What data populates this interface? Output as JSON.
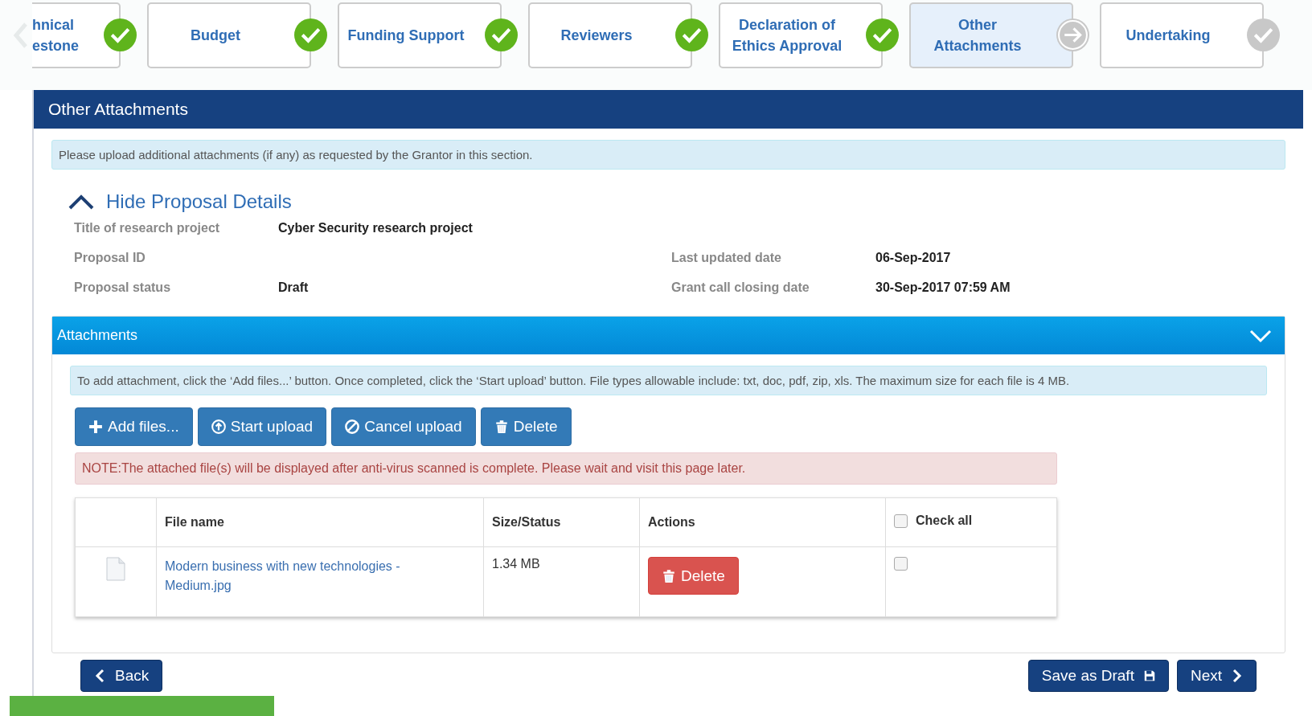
{
  "steps": [
    {
      "lines": [
        "hnical",
        "estone"
      ],
      "kind": "done",
      "selected": false
    },
    {
      "lines": [
        "Budget"
      ],
      "kind": "done",
      "selected": false
    },
    {
      "lines": [
        "Funding Support"
      ],
      "kind": "done",
      "selected": false
    },
    {
      "lines": [
        "Reviewers"
      ],
      "kind": "done",
      "selected": false
    },
    {
      "lines": [
        "Declaration of",
        "Ethics Approval"
      ],
      "kind": "done",
      "selected": false
    },
    {
      "lines": [
        "Other",
        "Attachments"
      ],
      "kind": "current",
      "selected": true
    },
    {
      "lines": [
        "Undertaking"
      ],
      "kind": "pending",
      "selected": false
    }
  ],
  "panel": {
    "title": "Other Attachments",
    "intro": "Please upload additional attachments (if any) as requested by the Grantor in this section."
  },
  "details": {
    "toggle": "Hide Proposal Details",
    "rows": [
      [
        {
          "label": "Title of research project",
          "value": "Cyber Security research project"
        }
      ],
      [
        {
          "label": "Proposal ID"
        },
        {
          "label": "Last updated date",
          "value": "06-Sep-2017"
        }
      ],
      [
        {
          "label": "Proposal status",
          "value": "Draft"
        },
        {
          "label": "Grant call closing date",
          "value": "30-Sep-2017 07:59 AM"
        }
      ]
    ]
  },
  "attachments": {
    "title": "Attachments",
    "help": "To add attachment, click the ‘Add files...’ button. Once completed, click the ‘Start upload’ button. File types allowable include: txt, doc, pdf, zip, xls. The maximum size for each file is 4 MB.",
    "toolbar": [
      {
        "label": "Add files...",
        "kind": "add"
      },
      {
        "label": "Start upload",
        "kind": "upload"
      },
      {
        "label": "Cancel upload",
        "kind": "cancel"
      },
      {
        "label": "Delete",
        "kind": "delete"
      }
    ],
    "note": "NOTE:The attached file(s) will be displayed after anti-virus scanned is complete. Please wait and visit this page later.",
    "columns": [
      "File name",
      "Size/Status",
      "Actions",
      "Check all"
    ],
    "check_all": false,
    "rows": [
      {
        "file": "Modern business with new technologies - Medium.jpg",
        "size": "1.34 MB",
        "action": "Delete",
        "checked": false
      }
    ]
  },
  "footer": {
    "back": "Back",
    "save": "Save as Draft",
    "next": "Next"
  }
}
